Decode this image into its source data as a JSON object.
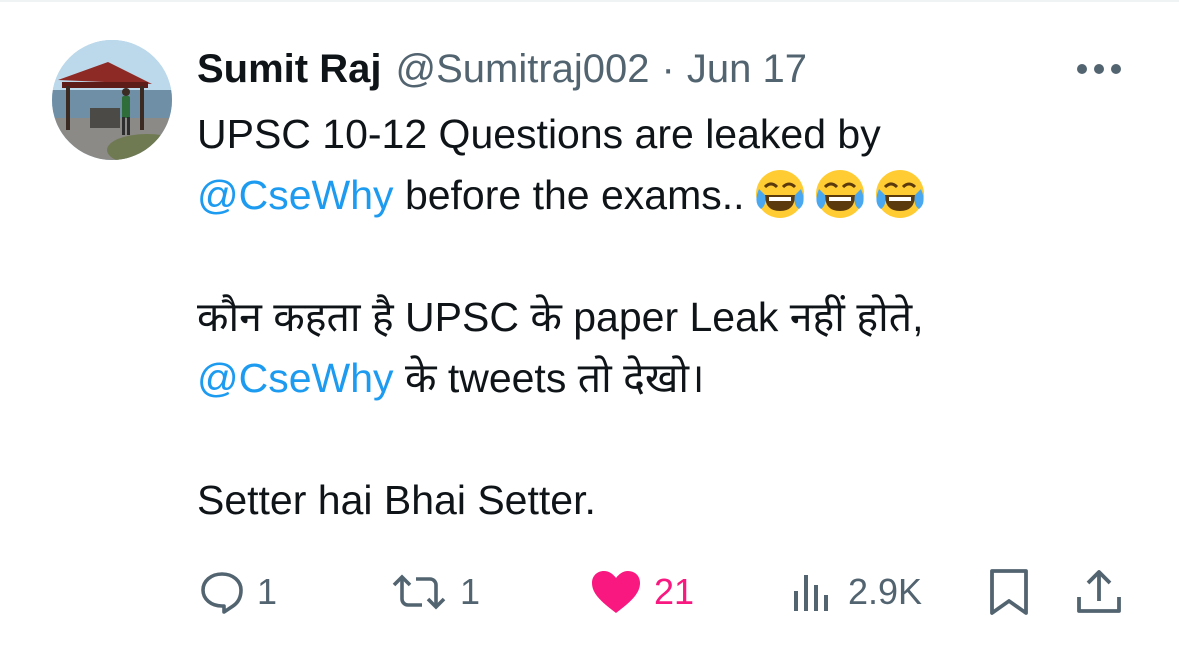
{
  "tweet": {
    "author_name": "Sumit Raj",
    "author_handle": "@Sumitraj002",
    "separator": "·",
    "date": "Jun 17",
    "line1": "UPSC 10-12 Questions are leaked by",
    "mention1": "@CseWhy",
    "line2_rest": " before the exams..",
    "emojis": [
      "face-with-tears-of-joy",
      "face-with-tears-of-joy",
      "face-with-tears-of-joy"
    ],
    "line3": "कौन कहता है UPSC के paper Leak नहीं होते,",
    "mention2": "@CseWhy",
    "line4_rest": " के tweets तो देखो।",
    "line5": "Setter hai Bhai Setter."
  },
  "actions": {
    "reply_count": "1",
    "retweet_count": "1",
    "like_count": "21",
    "views_count": "2.9K"
  },
  "colors": {
    "accent": "#1d9bf0",
    "like": "#f91880",
    "muted": "#536471",
    "text": "#0f1419"
  },
  "icons": [
    "more-icon",
    "reply-icon",
    "retweet-icon",
    "like-icon",
    "views-icon",
    "bookmark-icon",
    "share-icon"
  ]
}
